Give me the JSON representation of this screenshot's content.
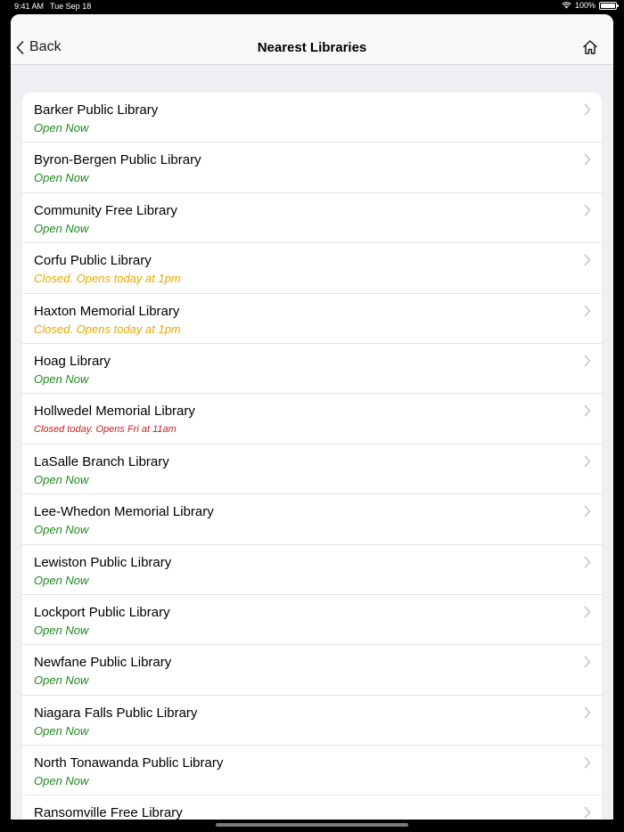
{
  "status_bar": {
    "time": "9:41 AM",
    "date": "Tue Sep 18",
    "battery": "100%"
  },
  "nav": {
    "back_label": "Back",
    "title": "Nearest Libraries"
  },
  "colors": {
    "open": "#1c8a1f",
    "opens_later": "#e8a800",
    "closed": "#d11a1a"
  },
  "libraries": [
    {
      "name": "Barker Public Library",
      "status": "Open Now",
      "state": "open"
    },
    {
      "name": "Byron-Bergen Public Library",
      "status": "Open Now",
      "state": "open"
    },
    {
      "name": "Community Free Library",
      "status": "Open Now",
      "state": "open"
    },
    {
      "name": "Corfu Public Library",
      "status": "Closed. Opens today at 1pm",
      "state": "later"
    },
    {
      "name": "Haxton Memorial Library",
      "status": "Closed. Opens today at 1pm",
      "state": "later"
    },
    {
      "name": "Hoag Library",
      "status": "Open Now",
      "state": "open"
    },
    {
      "name": "Hollwedel Memorial Library",
      "status": "Closed today. Opens Fri at 11am",
      "state": "closed"
    },
    {
      "name": "LaSalle Branch Library",
      "status": "Open Now",
      "state": "open"
    },
    {
      "name": "Lee-Whedon Memorial Library",
      "status": "Open Now",
      "state": "open"
    },
    {
      "name": "Lewiston Public Library",
      "status": "Open Now",
      "state": "open"
    },
    {
      "name": "Lockport Public Library",
      "status": "Open Now",
      "state": "open"
    },
    {
      "name": "Newfane Public Library",
      "status": "Open Now",
      "state": "open"
    },
    {
      "name": "Niagara Falls Public Library",
      "status": "Open Now",
      "state": "open"
    },
    {
      "name": "North Tonawanda Public Library",
      "status": "Open Now",
      "state": "open"
    },
    {
      "name": "Ransomville Free Library",
      "status": "",
      "state": "open"
    }
  ]
}
